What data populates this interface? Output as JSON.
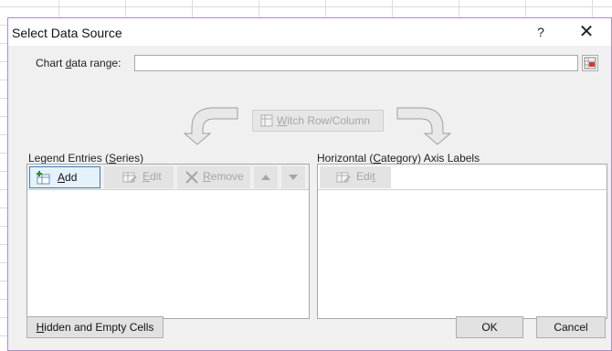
{
  "dialog": {
    "title": "Select Data Source",
    "help_label": "?",
    "close_label": "✕"
  },
  "range": {
    "label_pre": "Chart ",
    "label_key": "d",
    "label_post": "ata range:",
    "value": ""
  },
  "switch": {
    "label_key": "W",
    "label_post": "itch Row/Column"
  },
  "legend": {
    "title_pre": "Legend Entries (",
    "title_key": "S",
    "title_post": "eries)",
    "add_key": "A",
    "add_post": "dd",
    "edit_key": "E",
    "edit_post": "dit",
    "remove_key": "R",
    "remove_post": "emove"
  },
  "axis": {
    "title_pre": "Horizontal (",
    "title_key": "C",
    "title_post": "ategory) Axis Labels",
    "edit_pre": "Edi",
    "edit_key": "t"
  },
  "footer": {
    "hidden_key": "H",
    "hidden_post": "idden and Empty Cells",
    "ok_label": "OK",
    "cancel_label": "Cancel"
  },
  "colors": {
    "dialog_border": "#b28bc9",
    "active_button_border": "#3c7fb1",
    "disabled_text": "#a6a6a6"
  }
}
